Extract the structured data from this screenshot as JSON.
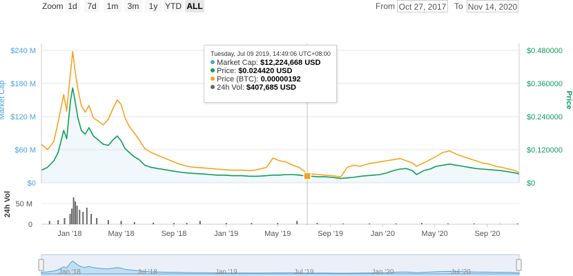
{
  "toolbar": {
    "zoom_label": "Zoom",
    "zoom_buttons": [
      "1d",
      "7d",
      "1m",
      "3m",
      "1y",
      "YTD",
      "ALL"
    ],
    "active_zoom": "ALL",
    "from_label": "From",
    "from_value": "Oct 27, 2017",
    "to_label": "To",
    "to_value": "Nov 14, 2020"
  },
  "tooltip": {
    "date": "Tuesday, Jul 09 2019, 14:49:06 UTC+08:00",
    "rows": [
      {
        "label": "Market Cap:",
        "value": "$12,224,668 USD",
        "color": "#4aa3df"
      },
      {
        "label": "Price:",
        "value": "$0.024420 USD",
        "color": "#0f9d58"
      },
      {
        "label": "Price (BTC):",
        "value": "0.00000192",
        "color": "#f7a21b"
      },
      {
        "label": "24h Vol:",
        "value": "$407,685 USD",
        "color": "#666666"
      }
    ]
  },
  "colors": {
    "market_cap": "#4aa3df",
    "price": "#0f9d58",
    "price_btc": "#f7a21b",
    "volume": "#666666",
    "navigator_fill": "#dde6f3"
  },
  "chart_data": {
    "type": "line",
    "x_tick_labels": [
      "Jan '18",
      "May '18",
      "Sep '18",
      "Jan '19",
      "May '19",
      "Sep '19",
      "Jan '20",
      "May '20",
      "Sep '20"
    ],
    "x_range": [
      "2017-10-27",
      "2020-11-14"
    ],
    "crosshair_date": "2019-07-09",
    "left_axis": {
      "label": "Market Cap",
      "ticks": [
        "$0",
        "$60 M",
        "$120 M",
        "$180 M",
        "$240 M"
      ],
      "range": [
        0,
        240
      ]
    },
    "right_axis": {
      "label": "Price",
      "ticks": [
        "$0",
        "$0.120000",
        "$0.240000",
        "$0.360000",
        "$0.480000"
      ],
      "range": [
        0,
        0.48
      ]
    },
    "volume_axis": {
      "label": "24h Vol",
      "ticks": [
        "0",
        "50 M"
      ]
    },
    "navigator_tick_labels": [
      "Jan '18",
      "Jul '18",
      "Jan '19",
      "Jul '19",
      "Jan '20",
      "Jul '20"
    ],
    "series": [
      {
        "name": "Market Cap",
        "axis": "left",
        "x": [
          "2017-10-27",
          "2017-11-10",
          "2017-11-25",
          "2017-12-05",
          "2017-12-18",
          "2017-12-25",
          "2018-01-03",
          "2018-01-08",
          "2018-01-13",
          "2018-01-20",
          "2018-01-28",
          "2018-02-06",
          "2018-02-15",
          "2018-02-25",
          "2018-03-08",
          "2018-03-20",
          "2018-04-01",
          "2018-04-12",
          "2018-04-22",
          "2018-05-01",
          "2018-05-10",
          "2018-05-20",
          "2018-05-30",
          "2018-06-12",
          "2018-06-25",
          "2018-07-10",
          "2018-07-25",
          "2018-08-10",
          "2018-08-25",
          "2018-09-10",
          "2018-10-01",
          "2018-10-20",
          "2018-11-10",
          "2018-11-25",
          "2018-12-10",
          "2018-12-25",
          "2019-01-15",
          "2019-02-05",
          "2019-02-25",
          "2019-03-15",
          "2019-04-05",
          "2019-04-20",
          "2019-05-05",
          "2019-05-20",
          "2019-06-05",
          "2019-06-20",
          "2019-07-09",
          "2019-07-20",
          "2019-08-05",
          "2019-08-20",
          "2019-09-05",
          "2019-09-15",
          "2019-09-25",
          "2019-10-10",
          "2019-10-25",
          "2019-11-10",
          "2019-11-25",
          "2019-12-10",
          "2019-12-25",
          "2020-01-10",
          "2020-01-25",
          "2020-02-10",
          "2020-02-25",
          "2020-03-10",
          "2020-03-20",
          "2020-04-05",
          "2020-04-20",
          "2020-05-05",
          "2020-05-20",
          "2020-06-05",
          "2020-06-20",
          "2020-07-05",
          "2020-07-20",
          "2020-08-05",
          "2020-08-20",
          "2020-09-05",
          "2020-09-20",
          "2020-10-05",
          "2020-10-20",
          "2020-11-05",
          "2020-11-14"
        ],
        "values": [
          23,
          28,
          40,
          55,
          95,
          80,
          150,
          172,
          150,
          118,
          95,
          88,
          100,
          85,
          78,
          70,
          68,
          78,
          85,
          76,
          62,
          55,
          48,
          42,
          32,
          28,
          26,
          24,
          22,
          20,
          18,
          17,
          16,
          15,
          14,
          14,
          13,
          13,
          12,
          12,
          13,
          14,
          14,
          15,
          15,
          14,
          12.2,
          12,
          11,
          11,
          10,
          9,
          8,
          9,
          10,
          12,
          13,
          14,
          15,
          18,
          22,
          25,
          26,
          22,
          15,
          22,
          25,
          30,
          32,
          34,
          32,
          30,
          28,
          26,
          25,
          24,
          23,
          22,
          20,
          18,
          16
        ]
      },
      {
        "name": "Price",
        "axis": "right",
        "x": [
          "2017-10-27",
          "2017-11-10",
          "2017-11-25",
          "2017-12-05",
          "2017-12-18",
          "2017-12-25",
          "2018-01-03",
          "2018-01-08",
          "2018-01-13",
          "2018-01-20",
          "2018-01-28",
          "2018-02-06",
          "2018-02-15",
          "2018-02-25",
          "2018-03-08",
          "2018-03-20",
          "2018-04-01",
          "2018-04-12",
          "2018-04-22",
          "2018-05-01",
          "2018-05-10",
          "2018-05-20",
          "2018-05-30",
          "2018-06-12",
          "2018-06-25",
          "2018-07-10",
          "2018-07-25",
          "2018-08-10",
          "2018-08-25",
          "2018-09-10",
          "2018-10-01",
          "2018-10-20",
          "2018-11-10",
          "2018-11-25",
          "2018-12-10",
          "2018-12-25",
          "2019-01-15",
          "2019-02-05",
          "2019-02-25",
          "2019-03-15",
          "2019-04-05",
          "2019-04-20",
          "2019-05-05",
          "2019-05-20",
          "2019-06-05",
          "2019-06-20",
          "2019-07-09",
          "2019-07-20",
          "2019-08-05",
          "2019-08-20",
          "2019-09-05",
          "2019-09-15",
          "2019-09-25",
          "2019-10-10",
          "2019-10-25",
          "2019-11-10",
          "2019-11-25",
          "2019-12-10",
          "2019-12-25",
          "2020-01-10",
          "2020-01-25",
          "2020-02-10",
          "2020-02-25",
          "2020-03-10",
          "2020-03-20",
          "2020-04-05",
          "2020-04-20",
          "2020-05-05",
          "2020-05-20",
          "2020-06-05",
          "2020-06-20",
          "2020-07-05",
          "2020-07-20",
          "2020-08-05",
          "2020-08-20",
          "2020-09-05",
          "2020-09-20",
          "2020-10-05",
          "2020-10-20",
          "2020-11-05",
          "2020-11-14"
        ],
        "values": [
          0.046,
          0.056,
          0.08,
          0.11,
          0.19,
          0.16,
          0.3,
          0.344,
          0.3,
          0.236,
          0.19,
          0.176,
          0.2,
          0.17,
          0.156,
          0.14,
          0.136,
          0.156,
          0.17,
          0.152,
          0.124,
          0.11,
          0.096,
          0.084,
          0.064,
          0.056,
          0.052,
          0.048,
          0.044,
          0.04,
          0.036,
          0.034,
          0.032,
          0.03,
          0.028,
          0.028,
          0.026,
          0.026,
          0.024,
          0.024,
          0.026,
          0.028,
          0.028,
          0.03,
          0.03,
          0.028,
          0.02442,
          0.024,
          0.022,
          0.022,
          0.02,
          0.018,
          0.016,
          0.018,
          0.02,
          0.024,
          0.026,
          0.028,
          0.03,
          0.036,
          0.044,
          0.05,
          0.052,
          0.044,
          0.03,
          0.044,
          0.05,
          0.06,
          0.064,
          0.068,
          0.064,
          0.06,
          0.056,
          0.052,
          0.05,
          0.048,
          0.046,
          0.044,
          0.04,
          0.036,
          0.032
        ]
      },
      {
        "name": "Price (BTC)",
        "axis": "left",
        "x": [
          "2017-10-27",
          "2017-11-10",
          "2017-11-25",
          "2017-12-05",
          "2017-12-18",
          "2017-12-25",
          "2018-01-03",
          "2018-01-08",
          "2018-01-13",
          "2018-01-20",
          "2018-01-28",
          "2018-02-06",
          "2018-02-15",
          "2018-02-25",
          "2018-03-08",
          "2018-03-20",
          "2018-04-01",
          "2018-04-12",
          "2018-04-22",
          "2018-05-01",
          "2018-05-10",
          "2018-05-20",
          "2018-05-30",
          "2018-06-12",
          "2018-06-25",
          "2018-07-10",
          "2018-07-25",
          "2018-08-10",
          "2018-08-25",
          "2018-09-10",
          "2018-10-01",
          "2018-10-20",
          "2018-11-10",
          "2018-11-25",
          "2018-12-10",
          "2018-12-25",
          "2019-01-15",
          "2019-02-05",
          "2019-02-25",
          "2019-03-15",
          "2019-04-05",
          "2019-04-20",
          "2019-05-05",
          "2019-05-20",
          "2019-06-05",
          "2019-06-20",
          "2019-07-09",
          "2019-07-20",
          "2019-08-05",
          "2019-08-20",
          "2019-09-05",
          "2019-09-15",
          "2019-09-25",
          "2019-10-10",
          "2019-10-25",
          "2019-11-10",
          "2019-11-25",
          "2019-12-10",
          "2019-12-25",
          "2020-01-10",
          "2020-01-25",
          "2020-02-10",
          "2020-02-25",
          "2020-03-10",
          "2020-03-20",
          "2020-04-05",
          "2020-04-20",
          "2020-05-05",
          "2020-05-20",
          "2020-06-05",
          "2020-06-20",
          "2020-07-05",
          "2020-07-20",
          "2020-08-05",
          "2020-08-20",
          "2020-09-05",
          "2020-09-20",
          "2020-10-05",
          "2020-10-20",
          "2020-11-05",
          "2020-11-14"
        ],
        "values": [
          70,
          60,
          75,
          110,
          160,
          130,
          200,
          238,
          205,
          170,
          140,
          128,
          140,
          118,
          112,
          105,
          115,
          135,
          150,
          142,
          118,
          102,
          92,
          78,
          62,
          55,
          50,
          45,
          40,
          35,
          30,
          28,
          27,
          26,
          25,
          24,
          23,
          23,
          22,
          24,
          28,
          45,
          40,
          38,
          32,
          28,
          17,
          16,
          15,
          14,
          13,
          12,
          11,
          28,
          32,
          30,
          34,
          36,
          38,
          40,
          42,
          44,
          40,
          36,
          30,
          36,
          42,
          48,
          55,
          58,
          52,
          48,
          44,
          40,
          36,
          34,
          30,
          28,
          25,
          22,
          18
        ]
      }
    ],
    "volume": {
      "name": "24h Vol",
      "x": [
        "2017-11-15",
        "2017-12-05",
        "2017-12-20",
        "2018-01-02",
        "2018-01-06",
        "2018-01-10",
        "2018-01-14",
        "2018-01-18",
        "2018-01-24",
        "2018-02-01",
        "2018-02-10",
        "2018-02-20",
        "2018-03-05",
        "2018-04-01",
        "2018-05-01",
        "2018-06-01",
        "2018-07-15",
        "2018-09-01",
        "2018-10-01",
        "2018-11-01",
        "2019-01-01",
        "2019-03-01",
        "2019-05-01",
        "2019-06-15",
        "2019-07-09",
        "2019-08-01",
        "2019-10-01",
        "2019-12-01",
        "2020-02-01",
        "2020-04-01",
        "2020-06-01",
        "2020-08-01",
        "2020-10-01",
        "2020-11-10"
      ],
      "values": [
        8,
        10,
        15,
        25,
        38,
        65,
        55,
        45,
        35,
        30,
        40,
        25,
        15,
        10,
        8,
        5,
        4,
        3,
        3,
        8,
        3,
        3,
        3,
        8,
        0.4,
        3,
        2,
        2,
        2,
        3,
        2,
        2,
        1,
        2
      ]
    }
  }
}
